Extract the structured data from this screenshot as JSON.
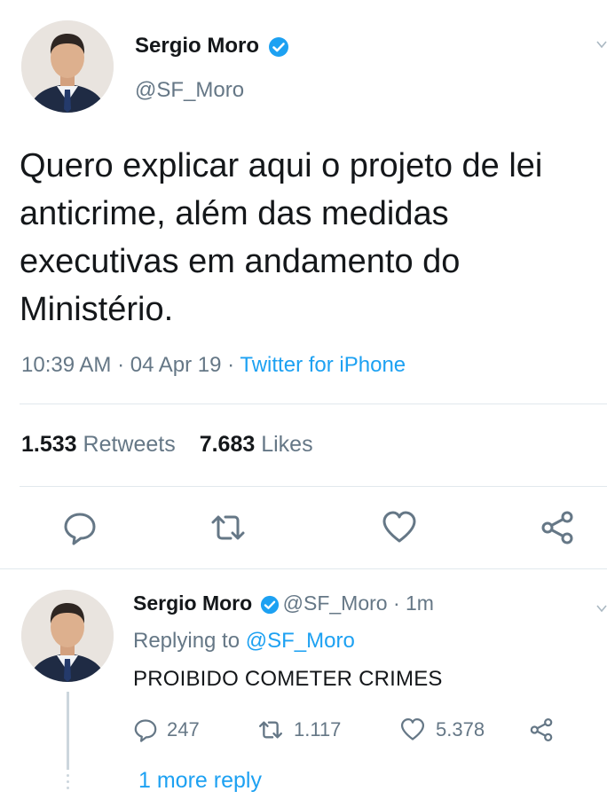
{
  "tweet": {
    "author_name": "Sergio Moro",
    "author_handle": "@SF_Moro",
    "text": "Quero explicar aqui o projeto de lei anticrime, além das medidas executivas em andamento do Ministério.",
    "time": "10:39 AM",
    "separator": " · ",
    "date": "04 Apr 19",
    "source": "Twitter for iPhone",
    "retweets_count": "1.533",
    "retweets_label": "Retweets",
    "likes_count": "7.683",
    "likes_label": "Likes"
  },
  "reply": {
    "author_name": "Sergio Moro",
    "author_handle": "@SF_Moro",
    "dot": " · ",
    "age": "1m",
    "replying_prefix": "Replying to ",
    "replying_to": "@SF_Moro",
    "text": "PROIBIDO COMETER CRIMES",
    "replies_count": "247",
    "retweets_count": "1.117",
    "likes_count": "5.378",
    "more_reply": "1 more reply"
  },
  "icons": {
    "verified": "verified-badge-icon",
    "reply": "reply-icon",
    "retweet": "retweet-icon",
    "like": "heart-icon",
    "share": "share-icon",
    "menu": "chevron-down-icon"
  },
  "colors": {
    "accent": "#1da1f2",
    "text": "#14171a",
    "secondary": "#657786",
    "divider": "#e1e8ed"
  }
}
